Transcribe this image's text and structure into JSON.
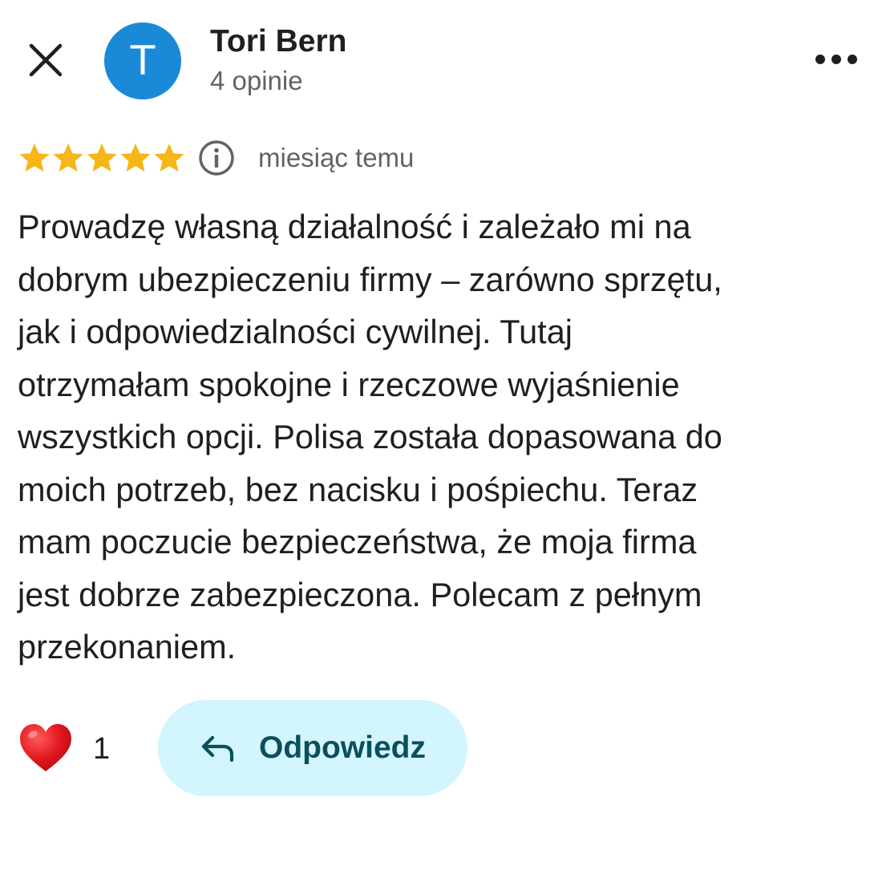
{
  "header": {
    "avatar_letter": "T",
    "avatar_color": "#1a8ad8",
    "author_name": "Tori Bern",
    "author_meta": "4 opinie",
    "close_icon": "close-icon",
    "more_icon": "more-horizontal-icon"
  },
  "review": {
    "rating": 5,
    "rating_max": 5,
    "star_color": "#f6b618",
    "info_icon": "info-icon",
    "date": "miesiąc temu",
    "text_lines": [
      "Prowadzę własną działalność i zależało mi na",
      "dobrym ubezpieczeniu firmy – zarówno sprzętu,",
      "jak i odpowiedzialności cywilnej. Tutaj",
      "otrzymałam spokojne i rzeczowe wyjaśnienie",
      "wszystkich opcji. Polisa została dopasowana do",
      "moich potrzeb, bez nacisku i pośpiechu. Teraz",
      "mam poczucie bezpieczeństwa, że moja firma",
      "jest dobrze zabezpieczona. Polecam z pełnym",
      "przekonaniem."
    ]
  },
  "actions": {
    "heart_icon": "heart-icon",
    "like_count": "1",
    "reply_label": "Odpowiedz",
    "reply_icon": "reply-arrow-icon",
    "reply_bg_color": "#d3f5fd"
  }
}
